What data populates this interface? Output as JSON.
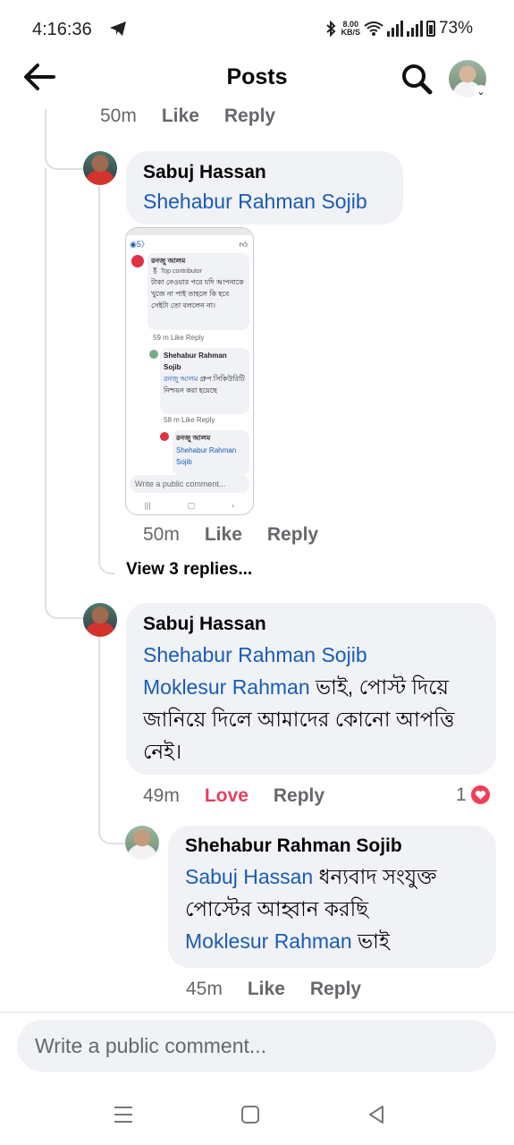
{
  "status_bar": {
    "time": "4:16:36",
    "net_speed": "8.00",
    "net_unit": "KB/S",
    "battery": "73%"
  },
  "header": {
    "title": "Posts"
  },
  "thread": {
    "top_meta": {
      "time": "50m",
      "like": "Like",
      "reply": "Reply"
    },
    "comment1": {
      "author": "Sabuj Hassan",
      "mention": "Shehabur Rahman Sojib",
      "meta": {
        "time": "50m",
        "like": "Like",
        "reply": "Reply"
      },
      "view_replies": "View 3 replies..."
    },
    "embedded_screenshot": {
      "top_count": "5",
      "c1_author": "রনজু আলম",
      "c1_badge": "Top contributor",
      "c1_text": "টাকা নেওয়ার পরে যদি আপনাকে খুজে না পাই তাহলে কি হবে সেইটা তো বললেন না।",
      "c1_meta": "59 m   Like   Reply",
      "c2_author": "Shehabur Rahman Sojib",
      "c2_mention": "রনজু আলম",
      "c2_text": "গ্রুপ সিকিউরিটি নিশ্চয়ন করা হয়েছে",
      "c2_meta": "58 m   Like   Reply",
      "c3_author": "রনজু আলম",
      "c3_mention": "Shehabur Rahman Sojib",
      "input": "Write a public comment..."
    },
    "comment2": {
      "author": "Sabuj Hassan",
      "mention1": "Shehabur Rahman Sojib",
      "mention2": "Moklesur Rahman",
      "text": " ভাই, পোস্ট দিয়ে জানিয়ে দিলে আমাদের কোনো আপত্তি নেই।",
      "meta": {
        "time": "49m",
        "love": "Love",
        "reply": "Reply",
        "reaction_count": "1"
      }
    },
    "comment3": {
      "author": "Shehabur Rahman Sojib",
      "mention1": "Sabuj Hassan",
      "text": " ধন্যবাদ সংযুক্ত পোস্টের আহ্বান করছি",
      "mention2": "Moklesur Rahman",
      "text2": "  ভাই",
      "meta": {
        "time": "45m",
        "like": "Like",
        "reply": "Reply"
      }
    }
  },
  "comment_input": {
    "placeholder": "Write a public comment..."
  },
  "colors": {
    "mention": "#1a5bb5",
    "love": "#e4405f",
    "bubble": "#f0f2f5"
  }
}
